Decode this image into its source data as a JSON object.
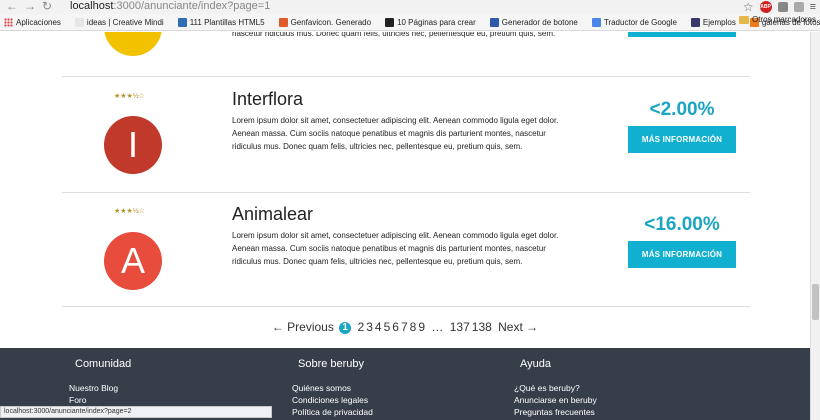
{
  "browser": {
    "url_host": "localhost",
    "url_path": ":3000/anunciante/index?page=1",
    "status_url": "localhost:3000/anunciante/index?page=2",
    "bookmarks": [
      {
        "label": "Aplicaciones",
        "color": "#d44"
      },
      {
        "label": "ideas | Creative Mindi",
        "color": "#e6e6e6"
      },
      {
        "label": "111 Plantillas HTML5",
        "color": "#2f6db5"
      },
      {
        "label": "Genfavicon. Generado",
        "color": "#e05a2a"
      },
      {
        "label": "10 Páginas para crear",
        "color": "#222222"
      },
      {
        "label": "Generador de botone",
        "color": "#2d5aa8"
      },
      {
        "label": "Traductor de Google",
        "color": "#4a86e8"
      },
      {
        "label": "Ejemplos",
        "color": "#3a3a6a"
      },
      {
        "label": "galerias de fotos",
        "color": "#f07b1b"
      }
    ],
    "other_bookmarks": "Otros marcadores"
  },
  "partial_top": {
    "desc_tail": "nascetur ridiculus mus. Donec quam felis, ultricies nec, pellentesque eu, pretium quis, sem.",
    "logo_color": "#f2c200"
  },
  "listings": [
    {
      "name": "Interflora",
      "initial": "I",
      "stars": "★★★½☆",
      "logo_color": "#c0392b",
      "description": "Lorem ipsum dolor sit amet, consectetuer adipiscing elit. Aenean commodo ligula eget dolor. Aenean massa. Cum sociis natoque penatibus et magnis dis parturient montes, nascetur ridiculus mus. Donec quam felis, ultricies nec, pellentesque eu, pretium quis, sem.",
      "percent": "<2.00%",
      "button": "MÁS INFORMACIÓN"
    },
    {
      "name": "Animalear",
      "initial": "A",
      "stars": "★★★½☆",
      "logo_color": "#e74c3c",
      "description": "Lorem ipsum dolor sit amet, consectetuer adipiscing elit. Aenean commodo ligula eget dolor. Aenean massa. Cum sociis natoque penatibus et magnis dis parturient montes, nascetur ridiculus mus. Donec quam felis, ultricies nec, pellentesque eu, pretium quis, sem.",
      "percent": "<16.00%",
      "button": "MÁS INFORMACIÓN"
    }
  ],
  "pagination": {
    "previous": "← Previous",
    "current": "1",
    "pages": [
      "2",
      "3",
      "4",
      "5",
      "6",
      "7",
      "8",
      "9"
    ],
    "ellipsis": "…",
    "last_pages": [
      "137",
      "138"
    ],
    "next": "Next →"
  },
  "footer": {
    "columns": [
      {
        "title": "Comunidad",
        "links": [
          "Nuestro Blog",
          "Foro"
        ]
      },
      {
        "title": "Sobre beruby",
        "links": [
          "Quiénes somos",
          "Condiciones legales",
          "Política de privacidad"
        ]
      },
      {
        "title": "Ayuda",
        "links": [
          "¿Qué es beruby?",
          "Anunciarse en beruby",
          "Preguntas frecuentes"
        ]
      }
    ]
  }
}
